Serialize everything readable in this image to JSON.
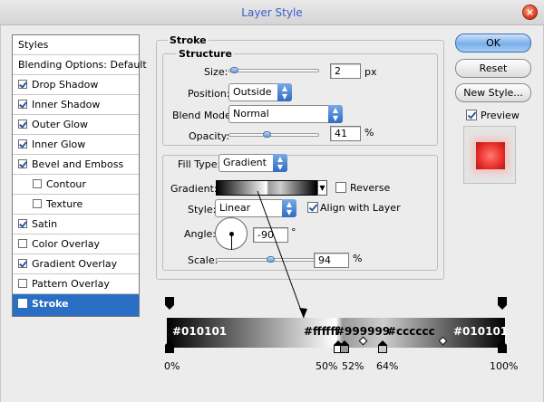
{
  "window": {
    "title": "Layer Style",
    "close": "×"
  },
  "sidebar": {
    "header": "Styles",
    "items": [
      {
        "label": "Blending Options: Default",
        "check": false,
        "has_check": false
      },
      {
        "label": "Drop Shadow",
        "check": true
      },
      {
        "label": "Inner Shadow",
        "check": true
      },
      {
        "label": "Outer Glow",
        "check": true
      },
      {
        "label": "Inner Glow",
        "check": true
      },
      {
        "label": "Bevel and Emboss",
        "check": true
      },
      {
        "label": "Contour",
        "check": false,
        "indent": true
      },
      {
        "label": "Texture",
        "check": false,
        "indent": true
      },
      {
        "label": "Satin",
        "check": true
      },
      {
        "label": "Color Overlay",
        "check": false
      },
      {
        "label": "Gradient Overlay",
        "check": true
      },
      {
        "label": "Pattern Overlay",
        "check": false
      },
      {
        "label": "Stroke",
        "check": true,
        "selected": true
      }
    ]
  },
  "stroke": {
    "title": "Stroke",
    "structure": {
      "title": "Structure",
      "size_label": "Size:",
      "size_value": "2",
      "size_unit": "px",
      "position_label": "Position:",
      "position_value": "Outside",
      "blend_label": "Blend Mode:",
      "blend_value": "Normal",
      "opacity_label": "Opacity:",
      "opacity_value": "41",
      "opacity_unit": "%"
    },
    "fill": {
      "fill_type_label": "Fill Type:",
      "fill_type_value": "Gradient",
      "gradient_label": "Gradient:",
      "reverse_label": "Reverse",
      "style_label": "Style:",
      "style_value": "Linear",
      "align_label": "Align with Layer",
      "angle_label": "Angle:",
      "angle_value": "-90",
      "angle_unit": "°",
      "scale_label": "Scale:",
      "scale_value": "94",
      "scale_unit": "%"
    }
  },
  "buttons": {
    "ok": "OK",
    "reset": "Reset",
    "new_style": "New Style...",
    "preview": "Preview"
  },
  "gradient_editor": {
    "stops": [
      {
        "color": "#010101",
        "location": "0%"
      },
      {
        "color": "#ffffff",
        "location": "50%"
      },
      {
        "color": "#999999",
        "location": "52%"
      },
      {
        "color": "#cccccc",
        "location": "64%"
      },
      {
        "color": "#010101",
        "location": "100%"
      }
    ]
  }
}
